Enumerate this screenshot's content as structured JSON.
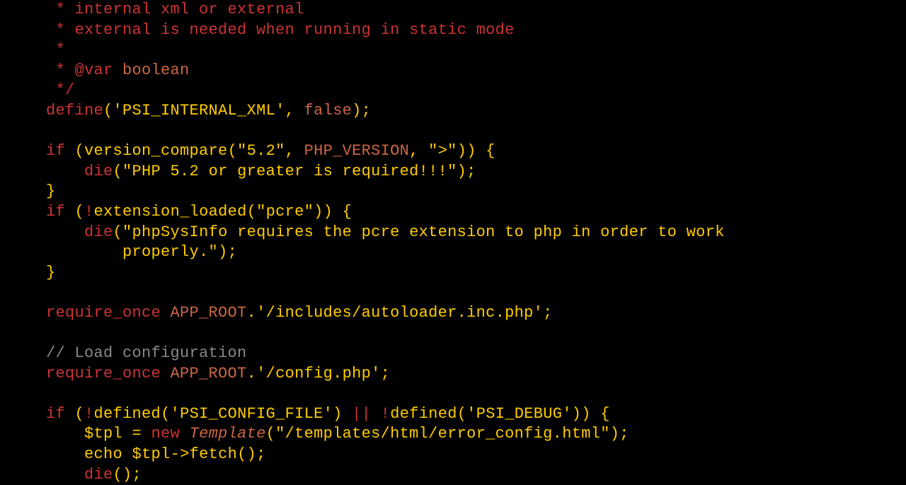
{
  "code": {
    "comment1": " * internal xml or external",
    "comment2": " * external is needed when running in static mode",
    "comment3": " *",
    "comment4_prefix": " * ",
    "comment4_tag": "@var",
    "comment4_type": " boolean",
    "comment5": " */",
    "define_kw": "define",
    "define_open": "(",
    "define_str": "'PSI_INTERNAL_XML'",
    "define_sep": ", ",
    "define_val": "false",
    "define_close": ");",
    "if1_kw": "if",
    "if1_open": " (",
    "if1_func": "version_compare",
    "if1_args_open": "(",
    "if1_arg1": "\"5.2\"",
    "if1_sep1": ", ",
    "if1_const": "PHP_VERSION",
    "if1_sep2": ", ",
    "if1_arg3": "\">\"",
    "if1_args_close": ")) {",
    "die1_kw": "die",
    "die1_open": "(",
    "die1_str": "\"PHP 5.2 or greater is required!!!\"",
    "die1_close": ");",
    "brace1": "}",
    "if2_kw": "if",
    "if2_open": " (",
    "if2_bang": "!",
    "if2_func": "extension_loaded",
    "if2_args_open": "(",
    "if2_arg": "\"pcre\"",
    "if2_args_close": ")) {",
    "die2_kw": "die",
    "die2_open": "(",
    "die2_str": "\"phpSysInfo requires the pcre extension to php in order to work",
    "die2_cont": "properly.\"",
    "die2_close": ");",
    "brace2": "}",
    "req1_kw": "require_once",
    "req1_sp": " ",
    "req1_const": "APP_ROOT",
    "req1_dot": ".",
    "req1_str": "'/includes/autoloader.inc.php'",
    "req1_end": ";",
    "loadcfg": "// Load configuration",
    "req2_kw": "require_once",
    "req2_sp": " ",
    "req2_const": "APP_ROOT",
    "req2_dot": ".",
    "req2_str": "'/config.php'",
    "req2_end": ";",
    "if3_kw": "if",
    "if3_open": " (",
    "if3_bang1": "!",
    "if3_func1": "defined",
    "if3_args1_open": "(",
    "if3_arg1": "'PSI_CONFIG_FILE'",
    "if3_args1_close": ") ",
    "if3_or": "||",
    "if3_sp": " ",
    "if3_bang2": "!",
    "if3_func2": "defined",
    "if3_args2_open": "(",
    "if3_arg2": "'PSI_DEBUG'",
    "if3_args2_close": ")) {",
    "tpl_var": "$tpl",
    "tpl_eq": " = ",
    "tpl_new": "new",
    "tpl_sp": " ",
    "tpl_class": "Template",
    "tpl_open": "(",
    "tpl_str": "\"/templates/html/error_config.html\"",
    "tpl_close": ");",
    "echo_kw": "echo",
    "echo_sp": " ",
    "echo_var": "$tpl",
    "echo_arrow": "->",
    "echo_method": "fetch",
    "echo_call": "();",
    "die3_kw": "die",
    "die3_call": "();"
  }
}
